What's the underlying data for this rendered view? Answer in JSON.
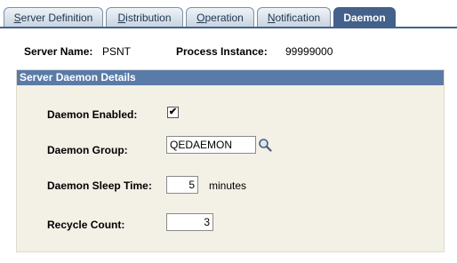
{
  "tabs": [
    {
      "access_key": "S",
      "rest": "erver Definition",
      "active": false
    },
    {
      "access_key": "D",
      "rest": "istribution",
      "active": false
    },
    {
      "access_key": "O",
      "rest": "peration",
      "active": false
    },
    {
      "access_key": "N",
      "rest": "otification",
      "active": false
    },
    {
      "label": "Daemon",
      "active": true
    }
  ],
  "header": {
    "server_name_label": "Server Name:",
    "server_name_value": "PSNT",
    "process_instance_label": "Process Instance:",
    "process_instance_value": "99999000"
  },
  "group": {
    "title": "Server Daemon Details",
    "daemon_enabled_label": "Daemon Enabled:",
    "daemon_enabled_checked": true,
    "daemon_group_label": "Daemon Group:",
    "daemon_group_value": "QEDAEMON",
    "sleep_time_label": "Daemon Sleep Time:",
    "sleep_time_value": "5",
    "sleep_time_unit": "minutes",
    "recycle_count_label": "Recycle Count:",
    "recycle_count_value": "3"
  },
  "colors": {
    "tab_active": "#44618b",
    "group_header": "#5a7ba8",
    "group_background": "#f3f0e6"
  },
  "icons": {
    "lookup": "magnifier-lookup-icon",
    "check": "checkmark-icon"
  }
}
